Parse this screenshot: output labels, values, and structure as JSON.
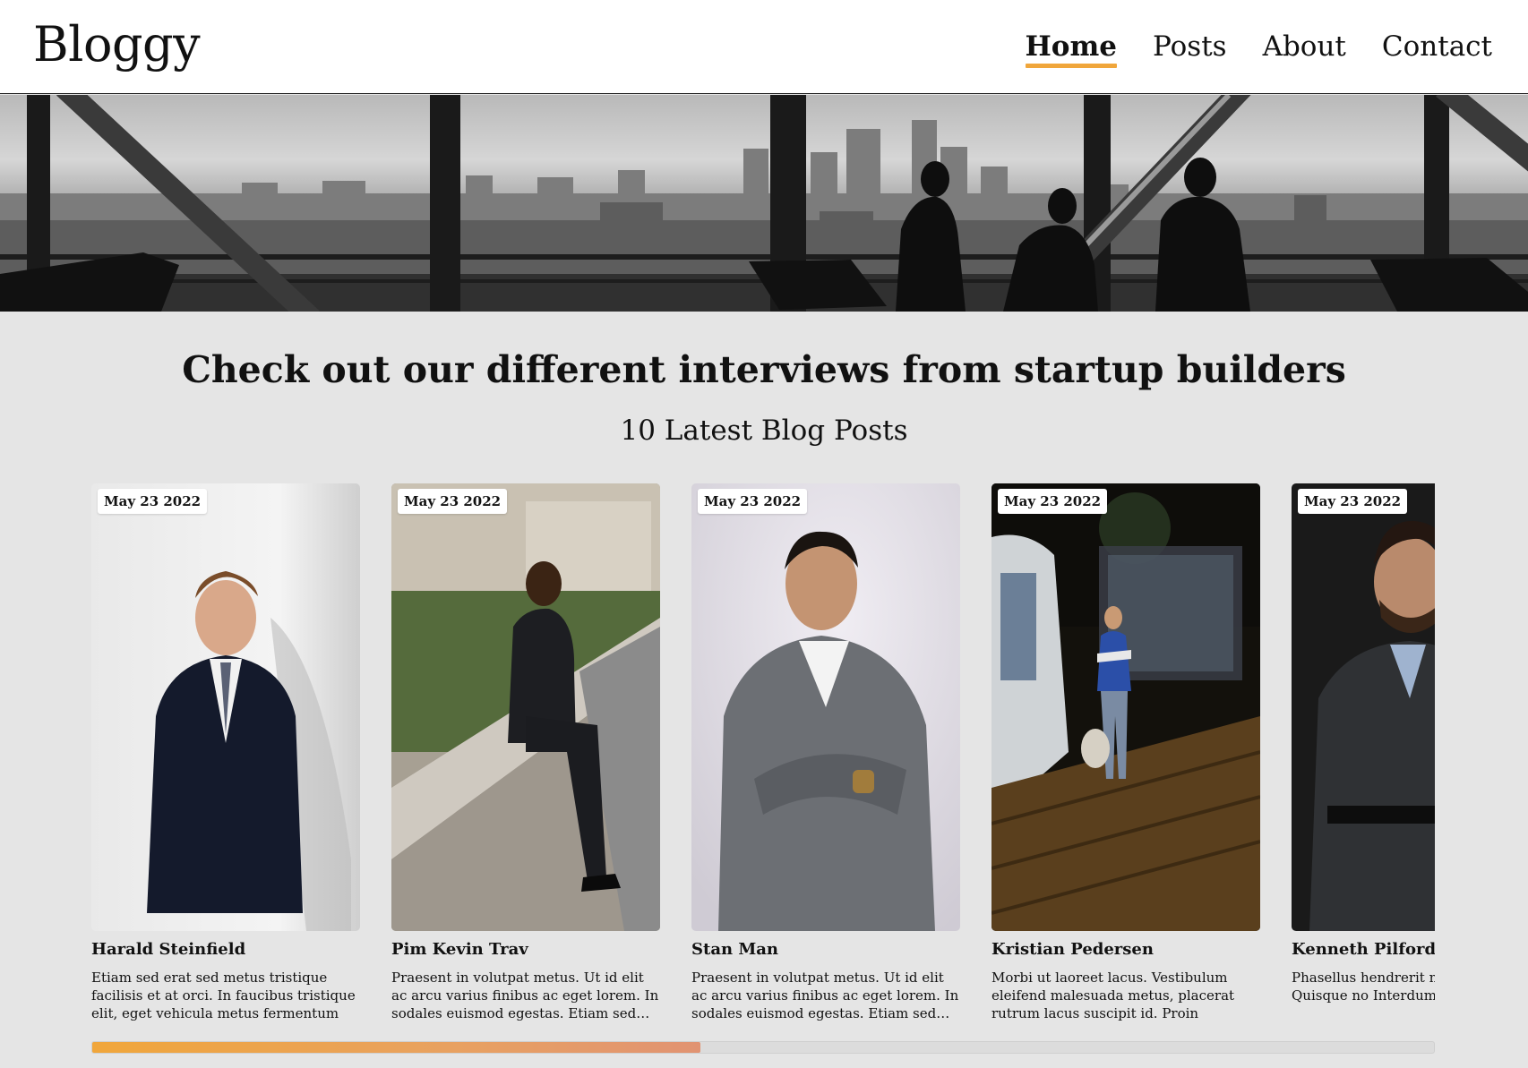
{
  "header": {
    "logo": "Bloggy",
    "nav": [
      {
        "label": "Home",
        "active": true
      },
      {
        "label": "Posts",
        "active": false
      },
      {
        "label": "About",
        "active": false
      },
      {
        "label": "Contact",
        "active": false
      }
    ]
  },
  "hero": {
    "image": "city-skyline-silhouettes"
  },
  "main": {
    "headline": "Check out our different interviews from startup builders",
    "subheadline": "10 Latest Blog Posts"
  },
  "posts": [
    {
      "date": "May 23 2022",
      "name": "Harald Steinfield",
      "excerpt": "Etiam sed erat sed metus tristique facilisis et at orci. In faucibus tristique elit, eget vehicula metus fermentum at.…",
      "photo": "man-dark-suit-white-backdrop"
    },
    {
      "date": "May 23 2022",
      "name": "Pim Kevin Trav",
      "excerpt": "Praesent in volutpat metus. Ut id elit ac arcu varius finibus ac eget lorem. In sodales euismod egestas. Etiam sed…",
      "photo": "man-sitting-on-wall-outdoors"
    },
    {
      "date": "May 23 2022",
      "name": "Stan Man",
      "excerpt": "Praesent in volutpat metus. Ut id elit ac arcu varius finibus ac eget lorem. In sodales euismod egestas. Etiam sed…",
      "photo": "man-grey-suit-arms-crossed"
    },
    {
      "date": "May 23 2022",
      "name": "Kristian Pedersen",
      "excerpt": "Morbi ut laoreet lacus. Vestibulum eleifend malesuada metus, placerat rutrum lacus suscipit id. Proin fringilla…",
      "photo": "man-with-dog-at-night"
    },
    {
      "date": "May 23 2022",
      "name": "Kenneth Pilford",
      "excerpt": "Phasellus hendrerit ma consequat. Quisque no Interdum et malesuada",
      "photo": "man-dark-portrait"
    }
  ],
  "scrollbar": {
    "progress": 0.453
  },
  "colors": {
    "accent": "#f0a63b",
    "background": "#e5e5e5",
    "header_bg": "#ffffff"
  }
}
